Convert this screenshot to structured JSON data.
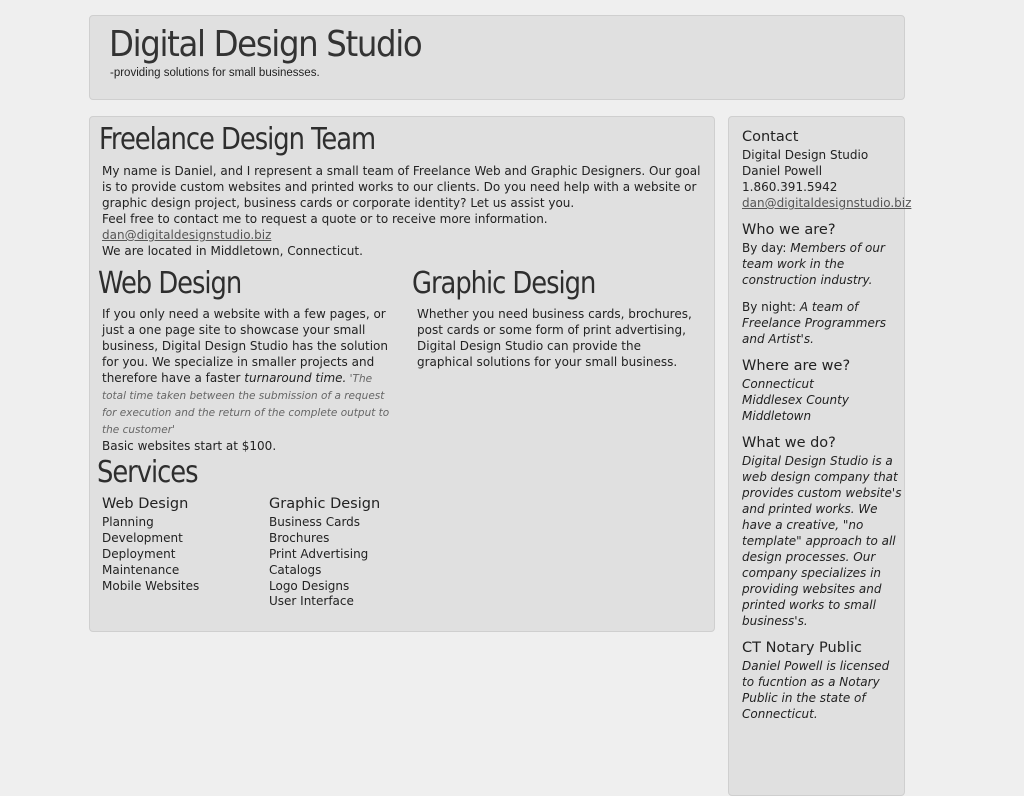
{
  "header": {
    "title": "Digital Design Studio",
    "tagline": "-providing solutions for small businesses."
  },
  "main": {
    "intro": {
      "heading": "Freelance Design Team",
      "line1": "My name is Daniel, and I represent a small team of Freelance Web and Graphic Designers. Our goal is to provide custom websites and printed works to our clients. Do you need help with a website or graphic design project, business cards or corporate identity? Let us assist you.",
      "line2": "Feel free to contact me to request a quote or to receive more information.",
      "email": "dan@digitaldesignstudio.biz",
      "location": "We are located in Middletown, Connecticut."
    },
    "web_design": {
      "heading": "Web Design",
      "text_before": "If you only need a website with a few pages, or just a one page site to showcase your small business, Digital Design Studio has the solution for you. We specialize in smaller projects and therefore have a faster ",
      "emphasis": "turnaround time.",
      "note": " 'The total time taken between the submission of a request for execution and the return of the complete output to the customer'",
      "price": "Basic websites start at $100."
    },
    "graphic_design": {
      "heading": "Graphic Design",
      "text": "Whether you need business cards, brochures, post cards or some form of print advertising, Digital Design Studio can provide the graphical solutions for your small business."
    },
    "services": {
      "heading": "Services",
      "web": {
        "title": "Web Design",
        "items": [
          "Planning",
          "Development",
          "Deployment",
          "Maintenance",
          "Mobile Websites"
        ]
      },
      "graphic": {
        "title": "Graphic Design",
        "items": [
          "Business Cards",
          "Brochures",
          "Print Advertising",
          "Catalogs",
          "Logo Designs",
          "User Interface"
        ]
      }
    }
  },
  "sidebar": {
    "contact": {
      "heading": "Contact",
      "company": "Digital Design Studio",
      "name": "Daniel Powell",
      "phone": "1.860.391.5942",
      "email": "dan@digitaldesignstudio.biz"
    },
    "who": {
      "heading": "Who we are?",
      "day_label": "By day: ",
      "day_text": "Members of our team work in the construction industry.",
      "night_label": "By night: ",
      "night_text": "A team of Freelance Programmers and Artist's."
    },
    "where": {
      "heading": "Where are we?",
      "line1": "Connecticut",
      "line2": "Middlesex County",
      "line3": "Middletown"
    },
    "what": {
      "heading": "What we do?",
      "text": "Digital Design Studio is a web design company that provides custom website's and printed works. We have a creative, \"no template\" approach to all design processes. Our company specializes in providing websites and printed works to small business's."
    },
    "notary": {
      "heading": "CT Notary Public",
      "text": "Daniel Powell is licensed to fucntion as a Notary Public in the state of Connecticut."
    }
  }
}
